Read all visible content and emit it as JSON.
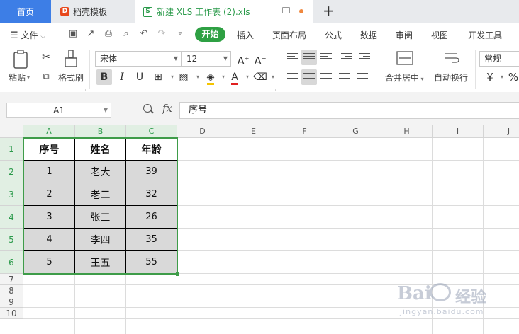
{
  "tabs": {
    "home": "首页",
    "template": "稻壳模板",
    "file": "新建 XLS 工作表 (2).xls",
    "template_icon": "D",
    "file_icon": "S"
  },
  "menu": {
    "file": "文件",
    "start": "开始",
    "items": [
      "插入",
      "页面布局",
      "公式",
      "数据",
      "审阅",
      "视图",
      "开发工具"
    ]
  },
  "ribbon": {
    "paste": "粘贴",
    "format_painter": "格式刷",
    "font_name": "宋体",
    "font_size": "12",
    "bold": "B",
    "italic": "I",
    "underline": "U",
    "merge_center": "合并居中",
    "wrap_text": "自动换行",
    "number_format": "常规",
    "currency": "¥",
    "percent": "%"
  },
  "formula_bar": {
    "name_box": "A1",
    "fx": "fx",
    "content": "序号"
  },
  "columns": [
    "A",
    "B",
    "C",
    "D",
    "E",
    "F",
    "G",
    "H",
    "I",
    "J"
  ],
  "rows": [
    "1",
    "2",
    "3",
    "4",
    "5",
    "6",
    "7",
    "8",
    "9",
    "10"
  ],
  "table": {
    "headers": [
      "序号",
      "姓名",
      "年龄"
    ],
    "rows": [
      [
        "1",
        "老大",
        "39"
      ],
      [
        "2",
        "老二",
        "32"
      ],
      [
        "3",
        "张三",
        "26"
      ],
      [
        "4",
        "李四",
        "35"
      ],
      [
        "5",
        "王五",
        "55"
      ]
    ]
  },
  "watermark": {
    "brand_a": "Bai",
    "brand_b": "经验",
    "url": "jingyan.baidu.com"
  },
  "colors": {
    "accent_green": "#2ea043",
    "home_tab_blue": "#3d7ee6",
    "selection_green": "#3e9c49"
  }
}
